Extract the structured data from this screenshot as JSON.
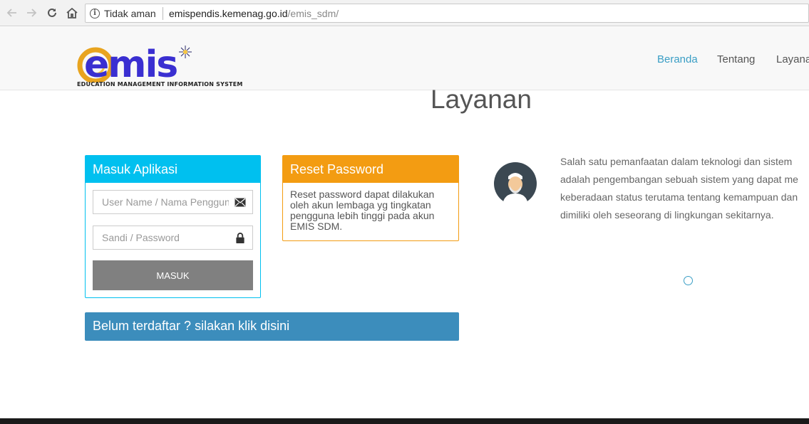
{
  "browser": {
    "security_label": "Tidak aman",
    "url_host": "emispendis.kemenag.go.id",
    "url_path": "/emis_sdm/"
  },
  "header": {
    "logo_text": "emis",
    "logo_subtitle": "EDUCATION MANAGEMENT INFORMATION SYSTEM",
    "menu": [
      {
        "label": "Beranda",
        "active": true
      },
      {
        "label": "Tentang",
        "active": false
      },
      {
        "label": "Layanan",
        "active": false
      }
    ]
  },
  "section_title": "Layanan",
  "login": {
    "title": "Masuk Aplikasi",
    "username_placeholder": "User Name / Nama Pengguna",
    "password_placeholder": "Sandi / Password",
    "submit_label": "MASUK"
  },
  "reset": {
    "title": "Reset Password",
    "body": "Reset password dapat dilakukan oleh akun lembaga yg tingkatan pengguna lebih tinggi pada akun EMIS SDM."
  },
  "register_label": "Belum terdaftar ? silakan klik disini",
  "description_lines": [
    "Salah satu pemanfaatan dalam teknologi dan sistem",
    "adalah pengembangan sebuah sistem yang dapat me",
    "keberadaan status terutama tentang kemampuan dan",
    "dimiliki oleh seseorang di lingkungan sekitarnya."
  ],
  "colors": {
    "login_accent": "#00c0ef",
    "reset_accent": "#f39c12",
    "register_bg": "#3c8dbc",
    "menu_active": "#3a9ec5"
  }
}
